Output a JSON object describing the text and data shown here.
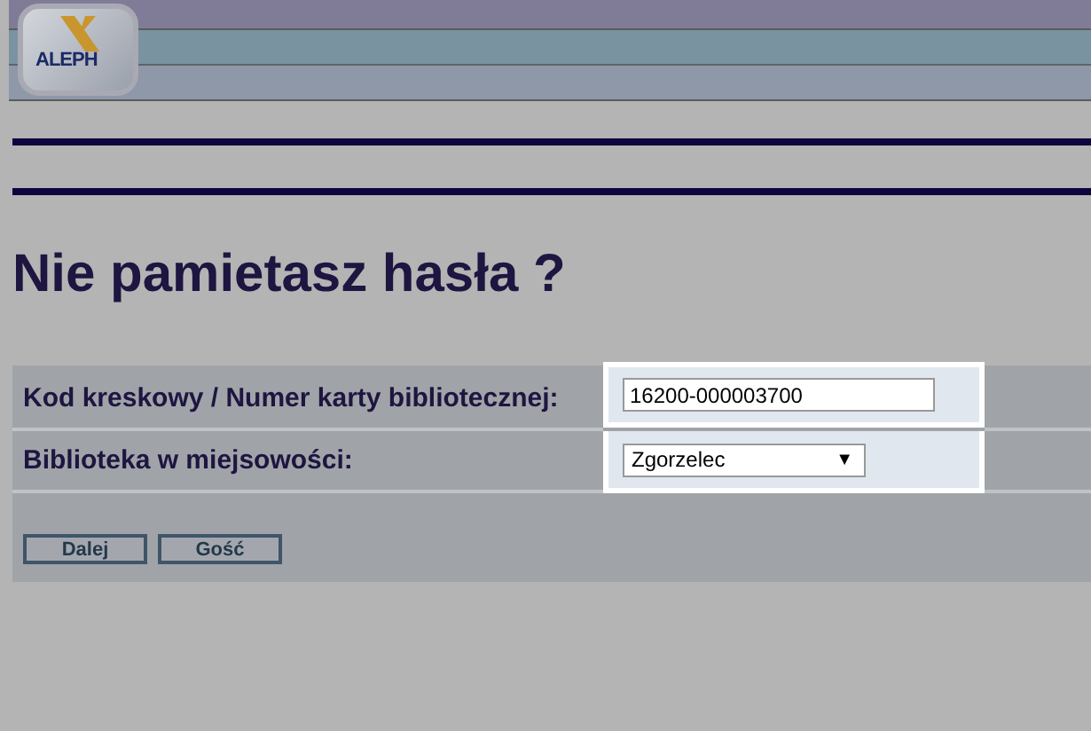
{
  "logo": {
    "text": "ALEPH"
  },
  "title": "Nie pamietasz hasła ?",
  "form": {
    "rows": [
      {
        "kind": "text",
        "label": "Kod kreskowy / Numer karty bibliotecznej:",
        "value": "16200-000003700"
      },
      {
        "kind": "select",
        "label": "Biblioteka w miejsowości:",
        "value": "Zgorzelec",
        "caret": "▼"
      }
    ],
    "buttons": [
      "Dalej",
      "Gość"
    ]
  }
}
